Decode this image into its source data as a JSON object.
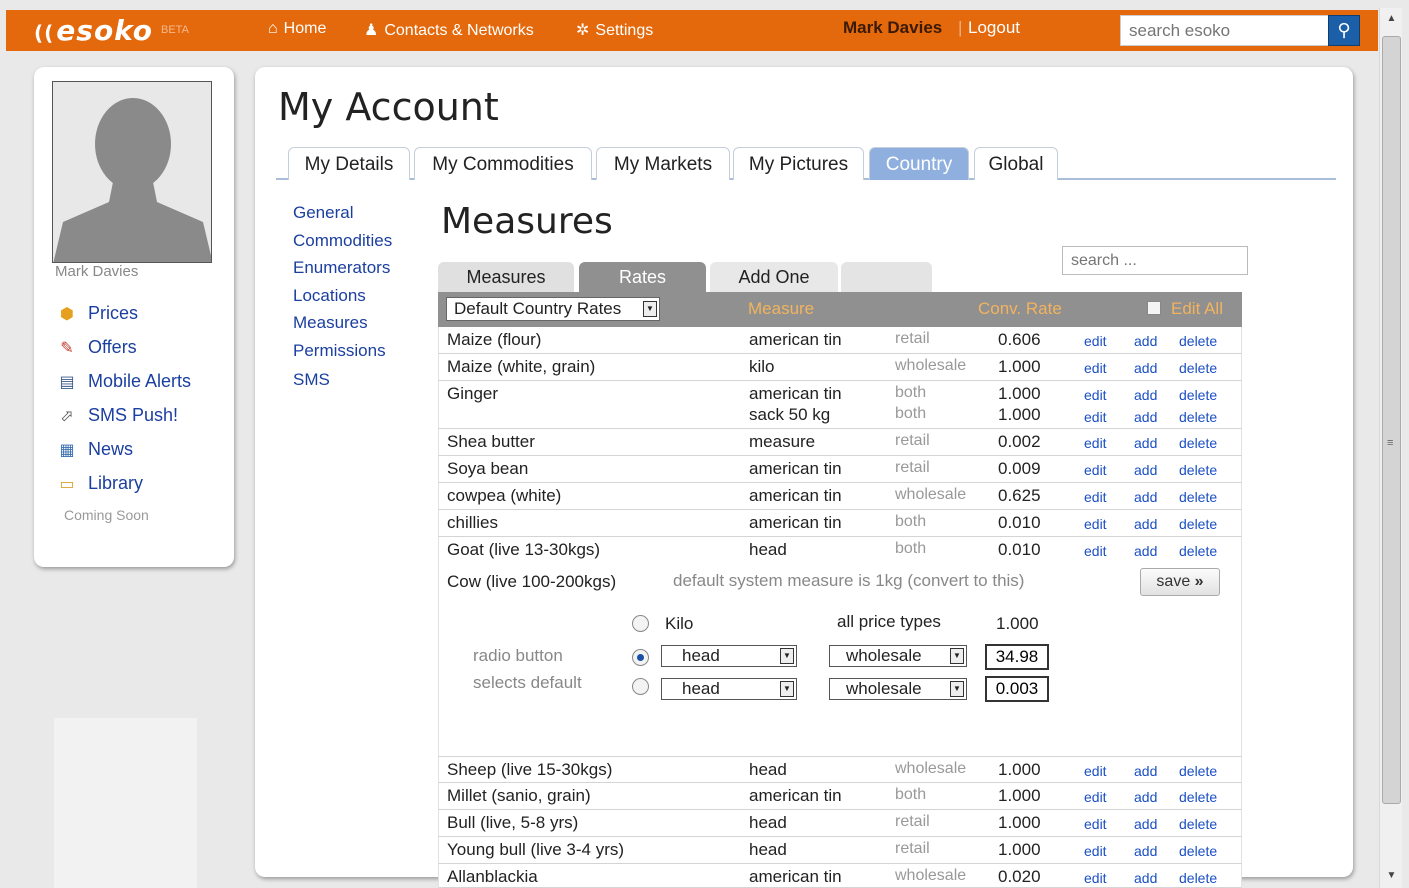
{
  "topbar": {
    "logo": "esoko",
    "beta": "BETA",
    "nav": [
      {
        "label": "Home",
        "icon": "home-icon"
      },
      {
        "label": "Contacts & Networks",
        "icon": "contacts-icon"
      },
      {
        "label": "Settings",
        "icon": "gear-icon"
      }
    ],
    "user_name": "Mark Davies",
    "separator": "|",
    "logout": "Logout",
    "search_placeholder": "search esoko",
    "accent_color": "#e4690c"
  },
  "sidebar": {
    "profile_name": "Mark Davies",
    "items": [
      {
        "label": "Prices",
        "icon": "prices-icon"
      },
      {
        "label": "Offers",
        "icon": "offers-icon"
      },
      {
        "label": "Mobile Alerts",
        "icon": "mobile-icon"
      },
      {
        "label": "SMS Push!",
        "icon": "sms-push-icon"
      },
      {
        "label": "News",
        "icon": "news-icon"
      },
      {
        "label": "Library",
        "icon": "folder-icon"
      }
    ],
    "coming_soon": "Coming Soon"
  },
  "main": {
    "title": "My Account",
    "tabs": [
      "My Details",
      "My Commodities",
      "My Markets",
      "My Pictures",
      "Country",
      "Global"
    ],
    "active_tab": "Country",
    "sublinks": [
      "General",
      "Commodities",
      "Enumerators",
      "Locations",
      "Measures",
      "Permissions",
      "SMS"
    ],
    "section_title": "Measures",
    "search_placeholder": "search ...",
    "subtabs": [
      "Measures",
      "Rates",
      "Add One",
      ""
    ],
    "active_subtab": "Rates",
    "table_header": {
      "select_value": "Default Country Rates",
      "measure": "Measure",
      "conv_rate": "Conv. Rate",
      "edit_all": "Edit All"
    },
    "actions": {
      "edit": "edit",
      "add": "add",
      "delete": "delete"
    },
    "rows_top": [
      {
        "commodity": "Maize (flour)",
        "measures": [
          {
            "measure": "american tin",
            "type": "retail",
            "rate": "0.606"
          }
        ]
      },
      {
        "commodity": "Maize (white, grain)",
        "measures": [
          {
            "measure": "kilo",
            "type": "wholesale",
            "rate": "1.000"
          }
        ]
      },
      {
        "commodity": "Ginger",
        "measures": [
          {
            "measure": "american tin",
            "type": "both",
            "rate": "1.000"
          },
          {
            "measure": "sack 50 kg",
            "type": "both",
            "rate": "1.000"
          }
        ]
      },
      {
        "commodity": "Shea butter",
        "measures": [
          {
            "measure": "measure",
            "type": "retail",
            "rate": "0.002"
          }
        ]
      },
      {
        "commodity": "Soya bean",
        "measures": [
          {
            "measure": "american tin",
            "type": "retail",
            "rate": "0.009"
          }
        ]
      },
      {
        "commodity": "cowpea (white)",
        "measures": [
          {
            "measure": "american tin",
            "type": "wholesale",
            "rate": "0.625"
          }
        ]
      },
      {
        "commodity": "chillies",
        "measures": [
          {
            "measure": "american tin",
            "type": "both",
            "rate": "0.010"
          }
        ]
      },
      {
        "commodity": "Goat (live 13-30kgs)",
        "measures": [
          {
            "measure": "head",
            "type": "both",
            "rate": "0.010"
          }
        ]
      }
    ],
    "expanded": {
      "commodity": "Cow (live 100-200kgs)",
      "note": "default system measure is 1kg (convert to this)",
      "save": "save",
      "save_arrow": "»",
      "kilo_label": "Kilo",
      "all_price_types": "all price types",
      "kilo_rate": "1.000",
      "hint_line1": "radio button",
      "hint_line2": "selects default",
      "options": [
        {
          "measure": "head",
          "type": "wholesale",
          "rate": "34.98",
          "selected": true
        },
        {
          "measure": "head",
          "type": "wholesale",
          "rate": "0.003",
          "selected": false
        }
      ]
    },
    "rows_bottom": [
      {
        "commodity": "Sheep (live 15-30kgs)",
        "measure": "head",
        "type": "wholesale",
        "rate": "1.000"
      },
      {
        "commodity": "Millet (sanio, grain)",
        "measure": "american tin",
        "type": "both",
        "rate": "1.000"
      },
      {
        "commodity": "Bull (live, 5-8 yrs)",
        "measure": "head",
        "type": "retail",
        "rate": "1.000"
      },
      {
        "commodity": "Young bull (live 3-4 yrs)",
        "measure": "head",
        "type": "retail",
        "rate": "1.000"
      },
      {
        "commodity": "Allanblackia",
        "measure": "american tin",
        "type": "wholesale",
        "rate": "0.020"
      }
    ]
  }
}
